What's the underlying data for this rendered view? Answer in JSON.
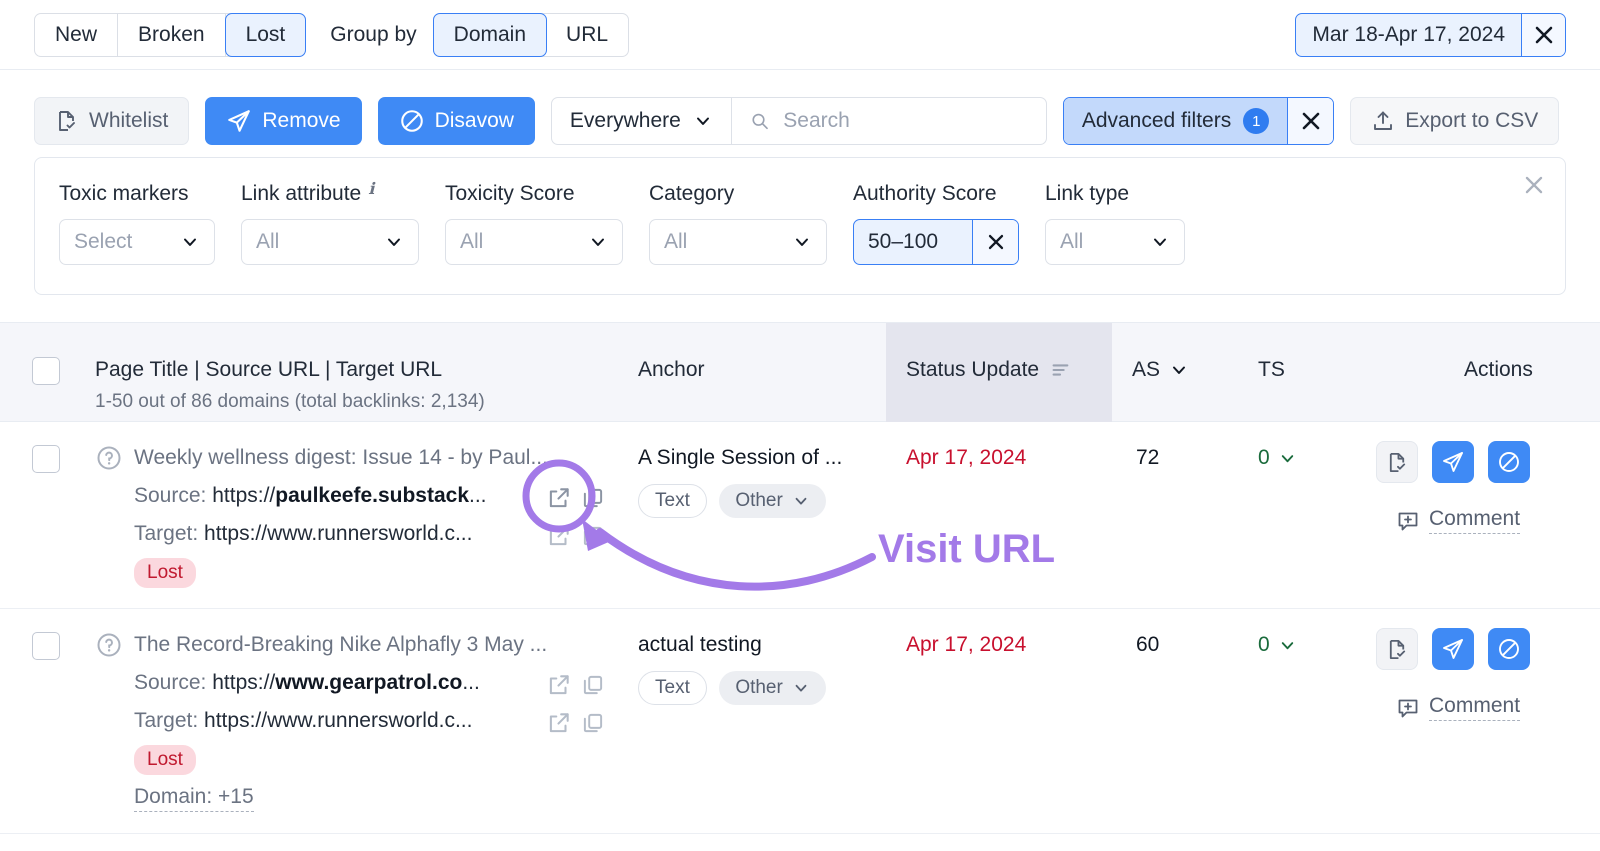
{
  "topbar": {
    "segments": [
      {
        "label": "New",
        "active": false
      },
      {
        "label": "Broken",
        "active": false
      },
      {
        "label": "Lost",
        "active": true
      }
    ],
    "group_by_label": "Group by",
    "group_by_options": [
      {
        "label": "Domain",
        "active": true
      },
      {
        "label": "URL",
        "active": false
      }
    ],
    "date_range": "Mar 18-Apr 17, 2024",
    "date_clear_icon": "close-icon"
  },
  "actionbar": {
    "whitelist_label": "Whitelist",
    "whitelist_icon": "file-check-icon",
    "remove_label": "Remove",
    "remove_icon": "paper-plane-icon",
    "disavow_label": "Disavow",
    "disavow_icon": "ban-icon",
    "search_scope": "Everywhere",
    "search_placeholder": "Search",
    "search_value": "",
    "search_icon": "search-icon",
    "advanced_filters_label": "Advanced filters",
    "advanced_filters_count": "1",
    "advanced_filters_clear_icon": "close-icon",
    "export_label": "Export to CSV",
    "export_icon": "upload-icon"
  },
  "filters": {
    "close_icon": "close-icon",
    "fields": [
      {
        "label": "Toxic markers",
        "value": "Select",
        "has_info": false,
        "active": false
      },
      {
        "label": "Link attribute",
        "value": "All",
        "has_info": true,
        "active": false
      },
      {
        "label": "Toxicity Score",
        "value": "All",
        "has_info": false,
        "active": false
      },
      {
        "label": "Category",
        "value": "All",
        "has_info": false,
        "active": false
      },
      {
        "label": "Authority Score",
        "value": "50–100",
        "has_info": false,
        "active": true
      },
      {
        "label": "Link type",
        "value": "All",
        "has_info": false,
        "active": false
      }
    ]
  },
  "table": {
    "headers": {
      "main": "Page Title | Source URL | Target URL",
      "subtitle": "1-50 out of 86 domains (total backlinks: 2,134)",
      "anchor": "Anchor",
      "status_update": "Status Update",
      "status_sort_icon": "sort-icon",
      "as": "AS",
      "as_sort_icon": "chevron-down-icon",
      "ts": "TS",
      "actions": "Actions"
    },
    "rows": [
      {
        "info_icon": "question-circle-icon",
        "title": "Weekly wellness digest: Issue 14 - by Paul...",
        "source_label": "Source:",
        "source_prefix": "https://",
        "source_domain": "paulkeefe.substack",
        "source_suffix": "...",
        "target_label": "Target:",
        "target_url": "https://www.runnersworld.c...",
        "status_badge": "Lost",
        "domain_more": "",
        "anchor": "A Single Session of ...",
        "anchor_type": "Text",
        "anchor_category": "Other",
        "status_update": "Apr 17, 2024",
        "as": "72",
        "ts": "0",
        "comment_label": "Comment",
        "comment_icon": "add-comment-icon",
        "action_icons": [
          "file-check-icon",
          "paper-plane-icon",
          "ban-icon"
        ]
      },
      {
        "info_icon": "question-circle-icon",
        "title": "The Record-Breaking Nike Alphafly 3 May ...",
        "source_label": "Source:",
        "source_prefix": "https://",
        "source_domain": "www.gearpatrol.co",
        "source_suffix": "...",
        "target_label": "Target:",
        "target_url": "https://www.runnersworld.c...",
        "status_badge": "Lost",
        "domain_more": "Domain: +15",
        "anchor": "actual testing",
        "anchor_type": "Text",
        "anchor_category": "Other",
        "status_update": "Apr 17, 2024",
        "as": "60",
        "ts": "0",
        "comment_label": "Comment",
        "comment_icon": "add-comment-icon",
        "action_icons": [
          "file-check-icon",
          "paper-plane-icon",
          "ban-icon"
        ]
      }
    ]
  },
  "annotation": {
    "label": "Visit URL",
    "color": "#a37ae8",
    "highlight_target": "external-link-icon"
  },
  "colors": {
    "accent_blue": "#3f8af5",
    "active_blue_bg": "#eaf2fe",
    "lost_badge_bg": "#fbd8de",
    "lost_badge_text": "#c0192f",
    "status_red": "#c8102e",
    "ts_green": "#1a6b3c",
    "annotation_purple": "#a37ae8"
  }
}
